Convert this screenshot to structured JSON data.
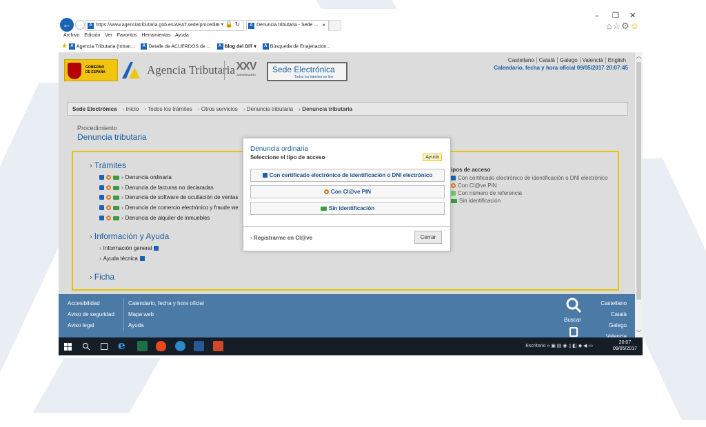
{
  "browser": {
    "address": "https://www.agenciatributaria.gob.es/AEAT.sede/procedim",
    "tab_title": "Denuncia tributaria - Sede ...",
    "tab_close": "×",
    "menu": [
      "Archivo",
      "Edición",
      "Ver",
      "Favoritos",
      "Herramientas",
      "Ayuda"
    ],
    "favorites": [
      "Agencia Tributaria (Intran...",
      "Detalle de ACUERDOS de ...",
      "Blog del DIT ▾",
      "Búsqueda de Enajenacion..."
    ],
    "window_controls": [
      "–",
      "❐",
      "✕"
    ]
  },
  "header": {
    "gob_line1": "GOBIERNO",
    "gob_line2": "DE ESPAÑA",
    "agency_name": "Agencia Tributaria",
    "xxv": "XXV",
    "xxv_sub": "ANIVERSARIO",
    "sede_title": "Sede Electrónica",
    "sede_sub": "Todos los trámites on line",
    "languages": [
      "Castellano",
      "Català",
      "Galego",
      "Valencià",
      "English"
    ],
    "datetime": "Calendario, fecha y hora oficial 09/05/2017 20:07:45"
  },
  "breadcrumb": {
    "root": "Sede Electrónica",
    "items": [
      "Inicio",
      "Todos los trámites",
      "Otros servicios",
      "Denuncia tributaria"
    ],
    "current": "Denuncia tributaria"
  },
  "procedure": {
    "label": "Procedimiento",
    "title": "Denuncia tributaria"
  },
  "sections": {
    "tramites": "Trámites",
    "tramites_items": [
      "Denuncia ordinaria",
      "Denuncia de facturas no declaradas",
      "Denuncia de software de ocultación de ventas",
      "Denuncia de comercio electrónico y fraude we",
      "Denuncia de alquiler de inmuebles"
    ],
    "info": "Información y Ayuda",
    "info_items": [
      "Información general",
      "Ayuda técnica"
    ],
    "ficha": "Ficha"
  },
  "access_types": {
    "title": "ipos de acceso",
    "items": [
      "Con certificado electrónico de identificación o DNI electrónico",
      "Con Cl@ve PIN",
      "Con número de referencia",
      "Sin identificación"
    ]
  },
  "modal": {
    "title": "Denuncia ordinaria",
    "subtitle": "Seleccione el tipo de acceso",
    "help": "Ayuda",
    "btn_cert": "Con certificado electrónico de identificación o DNI electrónico",
    "btn_clave": "Con Cl@ve PIN",
    "btn_none": "Sin identificación",
    "register": "Registrarme en Cl@ve",
    "close": "Cerrar"
  },
  "footer": {
    "col1": [
      "Accesibilidad",
      "Aviso de seguridad",
      "Aviso legal"
    ],
    "col2": [
      "Calendario, fecha y hora oficial",
      "Mapa web",
      "Ayuda"
    ],
    "search": "Buscar",
    "langs": [
      "Castellano",
      "Català",
      "Galego",
      "Valencia"
    ]
  },
  "taskbar": {
    "desktop": "Escritorio",
    "time": "20:07",
    "date": "09/05/2017"
  },
  "colors": {
    "accent": "#1a5fa0",
    "border_yellow": "#e6c200",
    "footer_bg": "#4b7aa6",
    "taskbar_bg": "#151d26"
  }
}
